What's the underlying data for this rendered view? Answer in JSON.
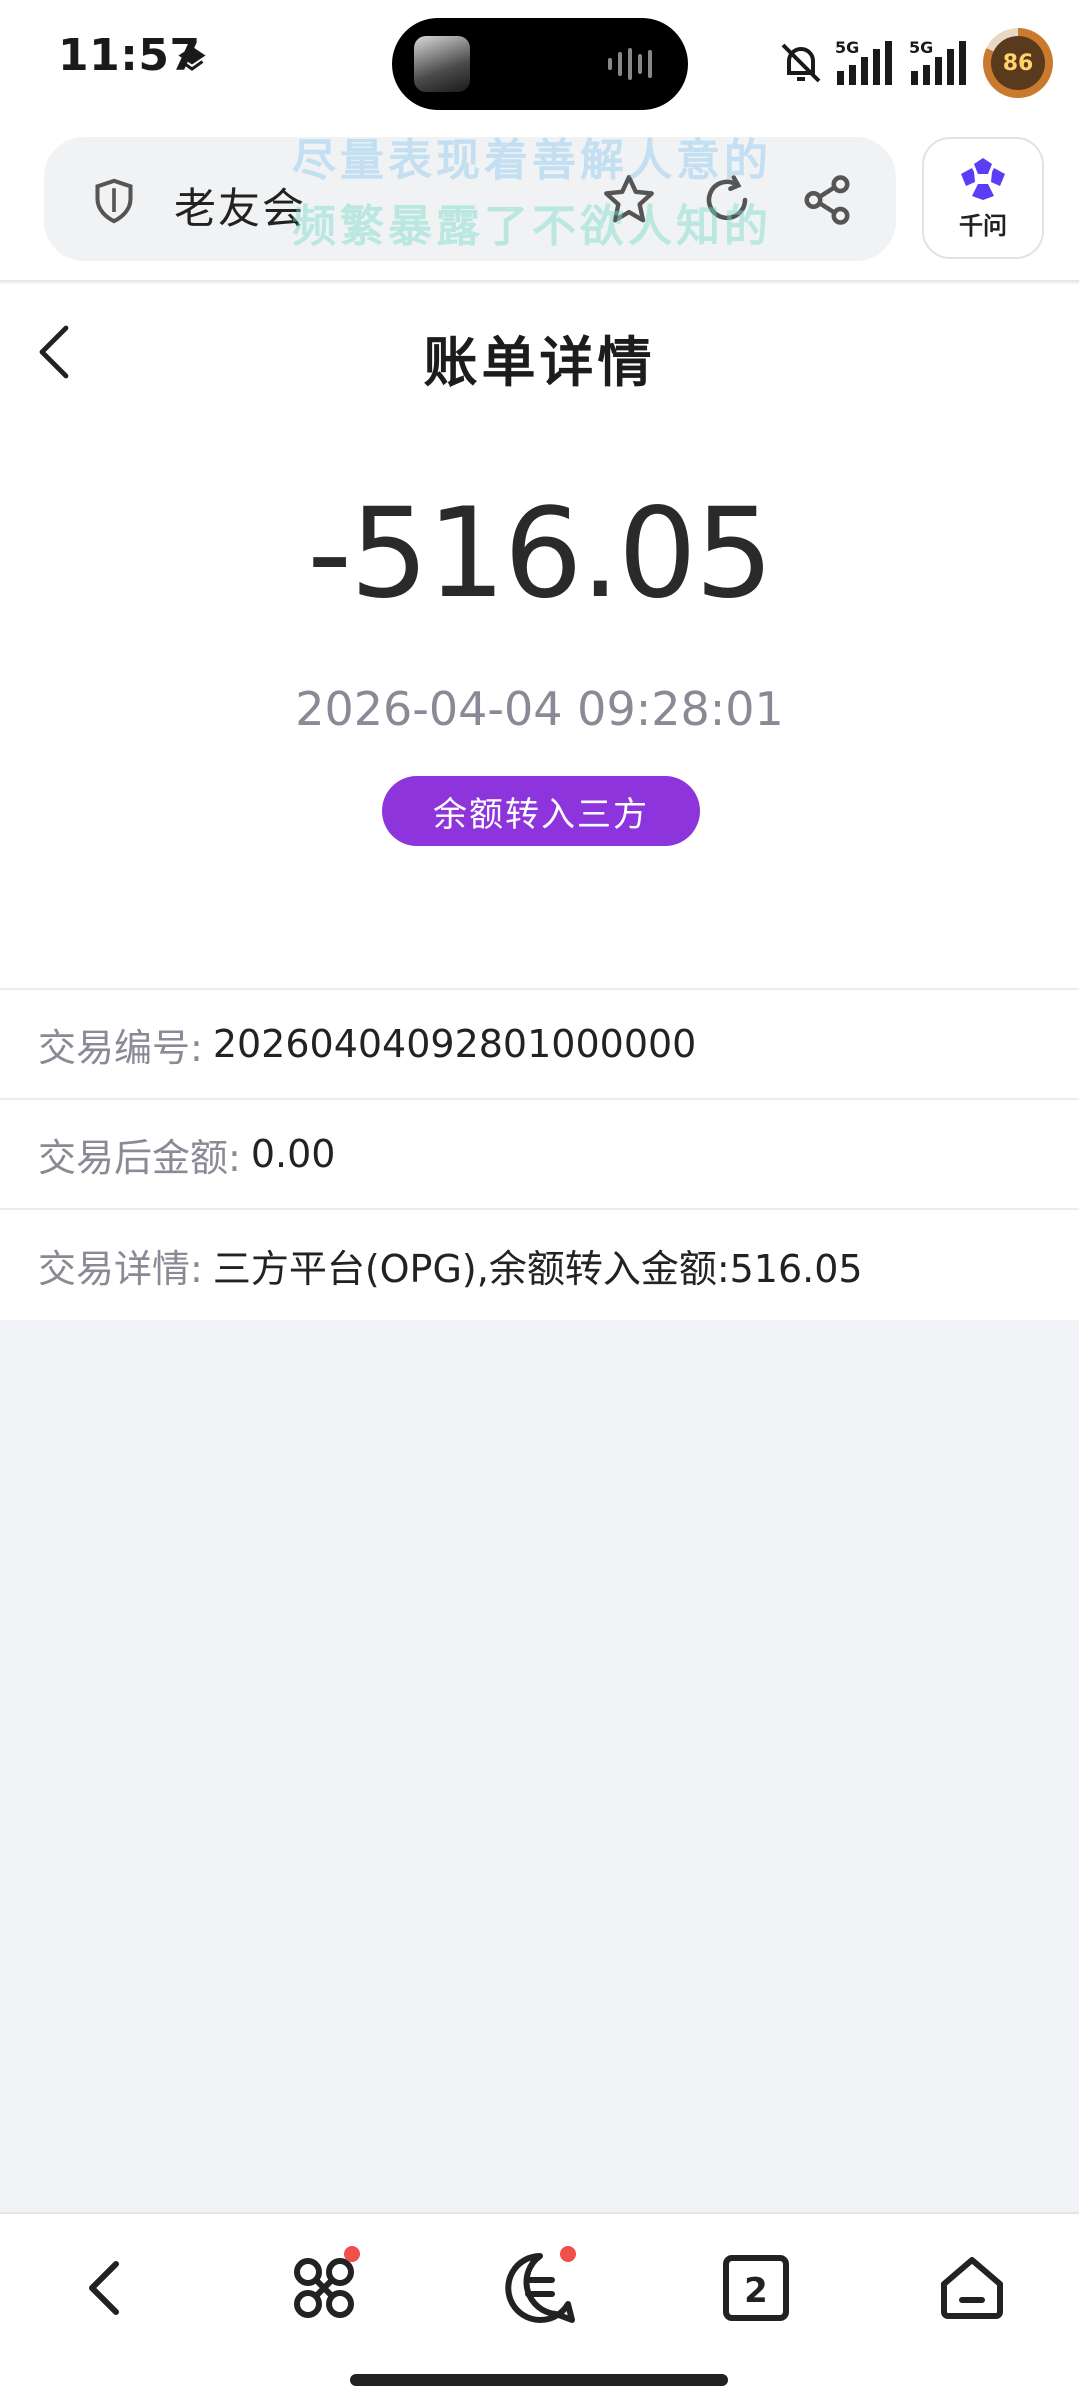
{
  "status_bar": {
    "time": "11:57",
    "network_1": "5G",
    "network_2": "5G",
    "battery": "86"
  },
  "browser": {
    "url_title": "老友会",
    "watermark_line1": "尽量表现着善解人意的",
    "watermark_line2": "频繁暴露了不欲人知的",
    "assistant_label": "千问"
  },
  "header": {
    "title": "账单详情"
  },
  "summary": {
    "amount": "-516.05",
    "datetime": "2026-04-04 09:28:01",
    "type_badge": "余额转入三方",
    "badge_color": "#8e34dc"
  },
  "details": [
    {
      "label": "交易编号:",
      "value": "20260404092801000000"
    },
    {
      "label": "交易后金额:",
      "value": "0.00"
    },
    {
      "label": "交易详情:",
      "value": "三方平台(OPG),余额转入金额:516.05"
    }
  ],
  "bottom_nav": {
    "tab_count": "2",
    "items": [
      "back-icon",
      "apps-icon",
      "messages-icon",
      "tabs-icon",
      "home-icon"
    ]
  }
}
